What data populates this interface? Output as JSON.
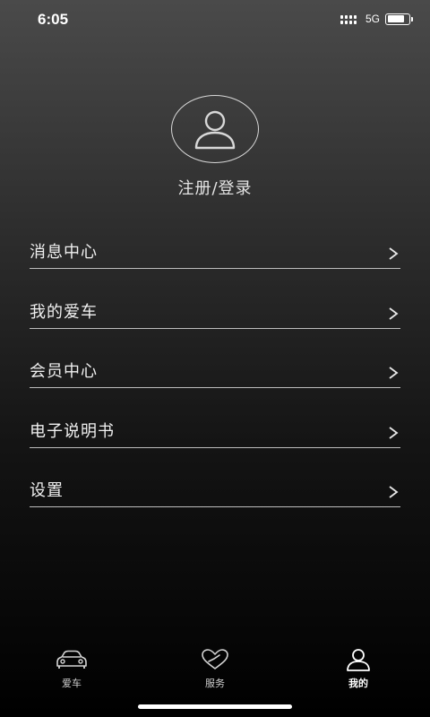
{
  "status_bar": {
    "time": "6:05",
    "network": "5G",
    "battery_level": 0.8
  },
  "profile": {
    "avatar_icon": "user-icon",
    "login_label": "注册/登录"
  },
  "menu": {
    "items": [
      {
        "label": "消息中心",
        "icon": "chevron-right-icon"
      },
      {
        "label": "我的爱车",
        "icon": "chevron-right-icon"
      },
      {
        "label": "会员中心",
        "icon": "chevron-right-icon"
      },
      {
        "label": "电子说明书",
        "icon": "chevron-right-icon"
      },
      {
        "label": "设置",
        "icon": "chevron-right-icon"
      }
    ]
  },
  "tab_bar": {
    "tabs": [
      {
        "label": "爱车",
        "icon": "car-icon",
        "active": false
      },
      {
        "label": "服务",
        "icon": "heart-service-icon",
        "active": false
      },
      {
        "label": "我的",
        "icon": "user-icon",
        "active": true
      }
    ]
  },
  "colors": {
    "background_top": "#4a4a4a",
    "background_bottom": "#000000",
    "text": "#f0f0f0",
    "divider": "#bdbdbd"
  }
}
